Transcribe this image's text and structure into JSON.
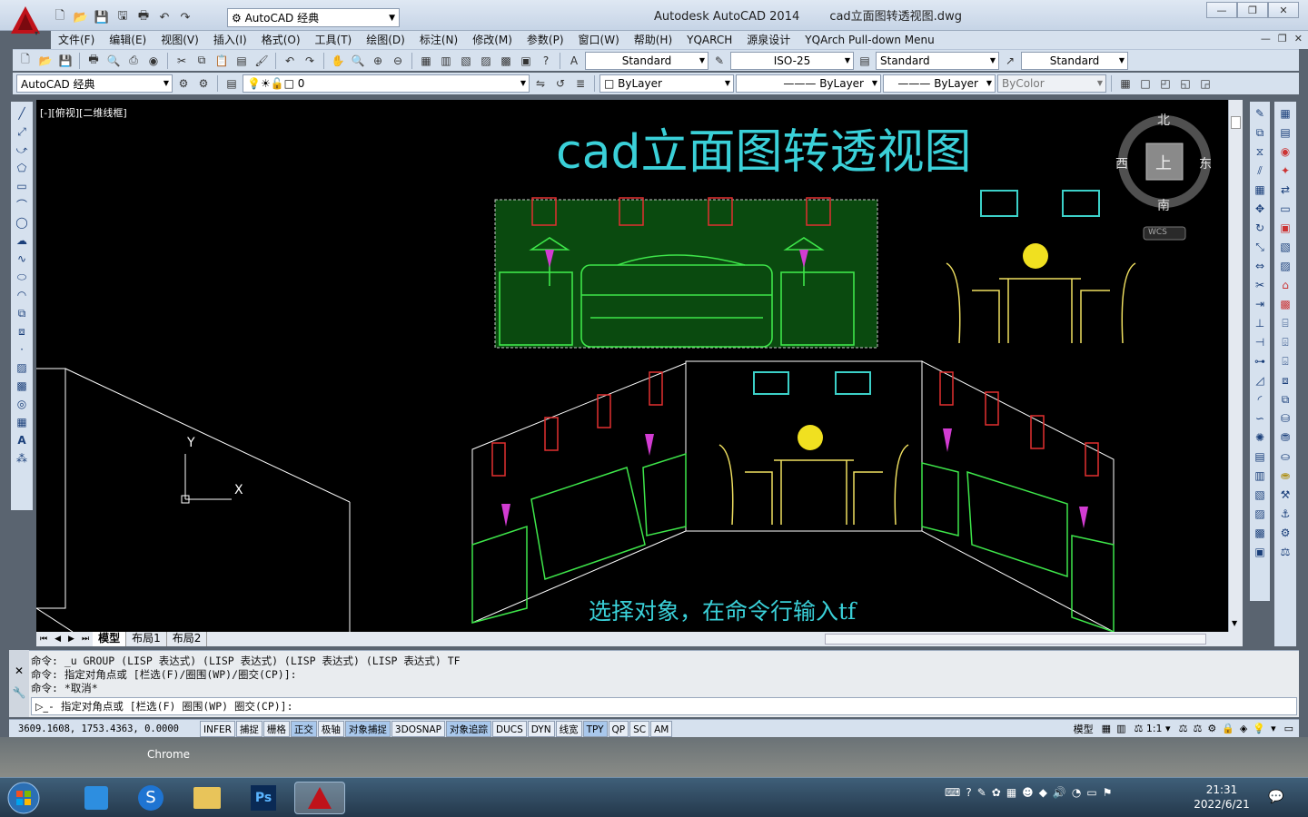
{
  "window": {
    "app_title": "Autodesk AutoCAD 2014",
    "file_title": "cad立面图转透视图.dwg",
    "workspace": "AutoCAD 经典",
    "colors": {
      "accent_red": "#c0121a",
      "canvas_bg": "#000000",
      "title_cyan": "#3ad0d8"
    }
  },
  "menu": {
    "items": [
      "文件(F)",
      "编辑(E)",
      "视图(V)",
      "插入(I)",
      "格式(O)",
      "工具(T)",
      "绘图(D)",
      "标注(N)",
      "修改(M)",
      "参数(P)",
      "窗口(W)",
      "帮助(H)",
      "YQARCH",
      "源泉设计",
      "YQArch Pull-down Menu"
    ]
  },
  "toolbar1": {
    "text_style": "Standard",
    "dim_style": "ISO-25",
    "table_style": "Standard",
    "mleader_style": "Standard"
  },
  "toolbar2": {
    "workspace": "AutoCAD 经典",
    "layer": "0",
    "color": "ByLayer",
    "linetype": "ByLayer",
    "lineweight": "ByLayer",
    "plotstyle": "ByColor"
  },
  "viewport": {
    "label": "[-][俯视][二维线框]",
    "drawing_title": "cad立面图转透视图",
    "hint_text": "选择对象，在命令行输入tf",
    "ucs_x": "X",
    "ucs_y": "Y"
  },
  "viewcube": {
    "north": "北",
    "south": "南",
    "east": "东",
    "west": "西",
    "face": "上",
    "wcs": "WCS"
  },
  "tabs": [
    "模型",
    "布局1",
    "布局2"
  ],
  "command": {
    "line1": "命令: _u GROUP (LISP 表达式) (LISP 表达式) (LISP 表达式) (LISP 表达式) TF",
    "line2": "命令: 指定对角点或 [栏选(F)/圈围(WP)/圈交(CP)]:",
    "line3": "命令: *取消*",
    "prompt": "- 指定对角点或 [栏选(F) 圈围(WP) 圈交(CP)]:"
  },
  "status": {
    "coords": "3609.1608, 1753.4363, 0.0000",
    "buttons": [
      "INFER",
      "捕捉",
      "栅格",
      "正交",
      "极轴",
      "对象捕捉",
      "3DOSNAP",
      "对象追踪",
      "DUCS",
      "DYN",
      "线宽",
      "TPY",
      "QP",
      "SC",
      "AM"
    ],
    "model": "模型",
    "scale": "1:1"
  },
  "desktop": {
    "chrome_label": "Chrome"
  },
  "taskbar": {
    "time": "21:31",
    "date": "2022/6/21"
  }
}
